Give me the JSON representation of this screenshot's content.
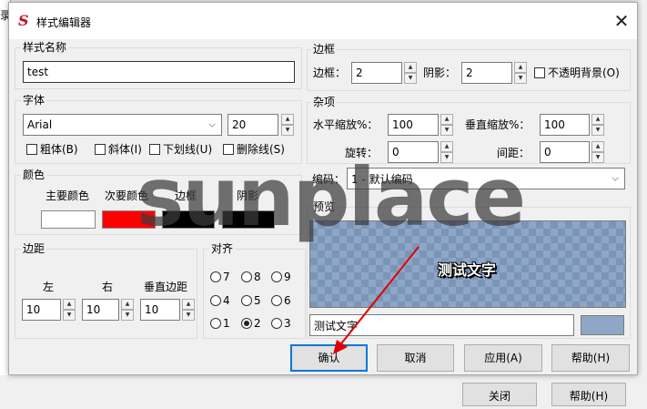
{
  "background": {
    "left_fragment": "录",
    "bottom_buttons": [
      "关闭",
      "帮助(H)"
    ]
  },
  "dialog": {
    "title": "样式编辑器",
    "close_glyph": "✕",
    "logo_glyph": "S",
    "accent_color": "#0078d7"
  },
  "style_name": {
    "label": "样式名称",
    "value": "test"
  },
  "font": {
    "label": "字体",
    "family": "Arial",
    "size": "20",
    "options": [
      "粗体(B)",
      "斜体(I)",
      "下划线(U)",
      "删除线(S)"
    ]
  },
  "color": {
    "label": "颜色",
    "items": [
      {
        "label": "主要颜色",
        "hex": "#ffffff"
      },
      {
        "label": "次要颜色",
        "hex": "#ff0000"
      },
      {
        "label": "边框",
        "hex": "#000000"
      },
      {
        "label": "阴影",
        "hex": "#000000"
      }
    ]
  },
  "margin": {
    "label": "边距",
    "left_label": "左",
    "left_value": "10",
    "right_label": "右",
    "right_value": "10",
    "vertical_label": "垂直边距",
    "vertical_value": "10"
  },
  "align": {
    "label": "对齐",
    "rows": [
      [
        "7",
        "8",
        "9"
      ],
      [
        "4",
        "5",
        "6"
      ],
      [
        "1",
        "2",
        "3"
      ]
    ],
    "selected": "2"
  },
  "border": {
    "label": "边框",
    "border_label": "边框：",
    "border_value": "2",
    "shadow_label": "阴影：",
    "shadow_value": "2",
    "opaque_label": "不透明背景(O)"
  },
  "misc": {
    "label": "杂项",
    "scale_x_label": "水平缩放%：",
    "scale_x_value": "100",
    "scale_y_label": "垂直缩放%：",
    "scale_y_value": "100",
    "rotate_label": "旋转：",
    "rotate_value": "0",
    "spacing_label": "间距：",
    "spacing_value": "0"
  },
  "encoding": {
    "label": "编码：",
    "value": "1 - 默认编码"
  },
  "preview": {
    "label": "预览",
    "sample_text": "测试文字",
    "input_value": "测试文字",
    "bg_color": "#8fa7c6"
  },
  "buttons": {
    "ok": "确认",
    "cancel": "取消",
    "apply": "应用(A)",
    "help": "帮助(H)"
  },
  "watermark": "sunplace"
}
